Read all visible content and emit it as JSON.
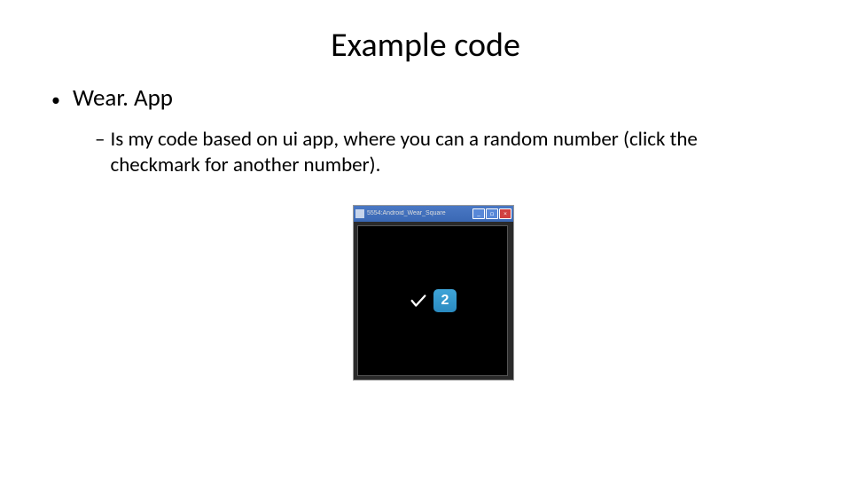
{
  "title": "Example code",
  "bullet1": "Wear. App",
  "bullet2": "Is my code based on ui app, where you can a random number (click the checkmark for another number).",
  "window_title": "5554:Android_Wear_Square",
  "random_number": "2"
}
